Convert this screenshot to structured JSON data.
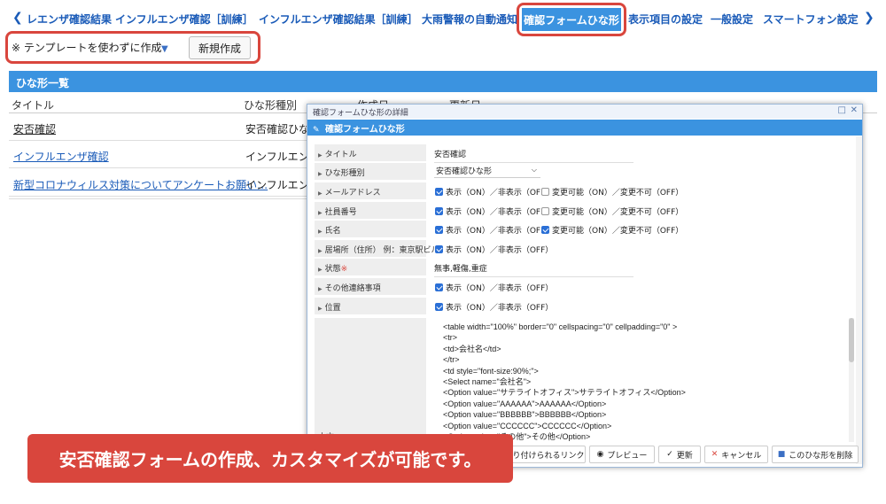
{
  "tabs": {
    "items": [
      "レエンザ確認結果",
      "インフルエンザ確認［訓練］",
      "インフルエンザ確認結果［訓練］",
      "大雨警報の自動通知",
      "確認フォームひな形",
      "表示項目の設定",
      "一般設定",
      "スマートフォン設定"
    ],
    "active": "確認フォームひな形"
  },
  "template": {
    "select_value": "※ テンプレートを使わずに作成",
    "new_button": "新規作成"
  },
  "list": {
    "header": "ひな形一覧",
    "columns": [
      "タイトル",
      "ひな形種別",
      "作成日",
      "更新日"
    ],
    "rows": [
      {
        "title": "安否確認",
        "kind": "安否確認ひな形"
      },
      {
        "title": "インフルエンザ確認",
        "kind": "インフルエン"
      },
      {
        "title": "新型コロナウィルス対策についてアンケートお願い…",
        "kind": "インフルエン"
      }
    ]
  },
  "modal": {
    "window_title": "確認フォームひな形の詳細",
    "header": "確認フォームひな形",
    "fields": {
      "title_label": "タイトル",
      "title_value": "安否確認",
      "kind_label": "ひな形種別",
      "kind_value": "安否確認ひな形",
      "email_label": "メールアドレス",
      "empno_label": "社員番号",
      "name_label": "氏名",
      "location_label": "居場所（住所） 例：東京駅ビル",
      "status_label": "状態",
      "status_required": "※",
      "status_value": "無事,軽傷,重症",
      "contact_label": "その他連絡事項",
      "position_label": "位置",
      "html_label": "本文"
    },
    "show_text": "表示（ON）／非表示（OFF）",
    "change_text": "変更可能（ON）／変更不可（OFF）",
    "checks": {
      "email_show": true,
      "email_change": false,
      "empno_show": true,
      "empno_change": false,
      "name_show": true,
      "name_change": true,
      "location_show": true,
      "contact_show": true,
      "position_show": true
    },
    "code": "<table width=\"100%\" border=\"0\" cellspacing=\"0\" cellpadding=\"0\" >\n<tr>\n<td>会社名</td>\n</tr>\n<td style=\"font-size:90%;\">\n<Select name=\"会社名\">\n<Option value=\"サテライトオフィス\">サテライトオフィス</Option>\n<Option value=\"AAAAAA\">AAAAAA</Option>\n<Option value=\"BBBBBB\">BBBBBB</Option>\n<Option value=\"CCCCCC\">CCCCCC</Option>\n<Option value=\"その他\">その他</Option>",
    "buttons": {
      "link": "り付けられるリンク",
      "preview": "プレビュー",
      "update": "更新",
      "cancel": "キャンセル",
      "delete": "このひな形を削除"
    }
  },
  "banner": "安否確認フォームの作成、カスタマイズが可能です。",
  "colors": {
    "accent": "#3b93e0",
    "highlight": "#d9463d",
    "link": "#1a5bb8"
  },
  "icons": {
    "tab_prev": "chevron-left-icon",
    "tab_next": "chevron-right-icon",
    "caret": "caret-down-icon",
    "preview": "eye-icon",
    "update": "check-icon",
    "cancel": "close-icon",
    "delete": "trash-icon"
  }
}
